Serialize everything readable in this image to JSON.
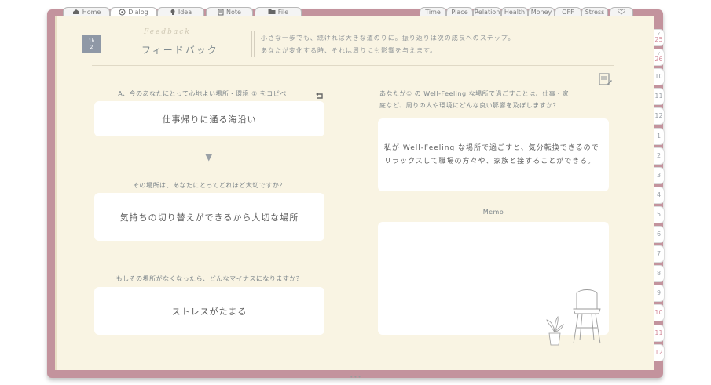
{
  "tabs_left": [
    {
      "label": "Home",
      "icon": "home-icon"
    },
    {
      "label": "Dialog",
      "icon": "dialog-icon"
    },
    {
      "label": "Idea",
      "icon": "lightbulb-icon"
    },
    {
      "label": "Note",
      "icon": "note-icon"
    },
    {
      "label": "File",
      "icon": "folder-icon"
    }
  ],
  "tabs_right": [
    {
      "label": "Time"
    },
    {
      "label": "Place"
    },
    {
      "label": "Relation"
    },
    {
      "label": "Health"
    },
    {
      "label": "Money"
    },
    {
      "label": "OFF"
    },
    {
      "label": "Stress"
    },
    {
      "label": "",
      "icon": "heart-icon"
    }
  ],
  "month_tabs": [
    {
      "year": "Y",
      "label": "25"
    },
    {
      "year": "Y",
      "label": "26"
    },
    {
      "label": "10"
    },
    {
      "label": "11"
    },
    {
      "label": "12"
    },
    {
      "label": "1"
    },
    {
      "label": "2"
    },
    {
      "label": "3"
    },
    {
      "label": "4"
    },
    {
      "label": "5"
    },
    {
      "label": "6"
    },
    {
      "label": "7"
    },
    {
      "label": "8"
    },
    {
      "label": "9"
    },
    {
      "label": "10"
    },
    {
      "label": "11"
    },
    {
      "label": "12"
    }
  ],
  "header": {
    "day_top": "1h",
    "day_bottom": "2",
    "script_title": "Feedback",
    "title": "フィードバック",
    "intro_line1": "小さな一歩でも、続ければ大きな道のりに。振り返りは次の成長へのステップ。",
    "intro_line2": "あなたが変化する時、それは周りにも影響を与えます。"
  },
  "left": {
    "q1": "A、今のあなたにとって心地よい場所・環境 ① をコピペ",
    "a1": "仕事帰りに通る海沿い",
    "arrow": "▼",
    "q2": "その場所は、あなたにとってどれほど大切ですか？",
    "a2": "気持ちの切り替えができるから大切な場所",
    "q3": "もしその場所がなくなったら、どんなマイナスになりますか？",
    "a3": "ストレスがたまる"
  },
  "right": {
    "q1_line1": "あなたが① の Well-Feeling な場所で過ごすことは、仕事・家",
    "q1_line2": "庭など、周りの人や環境にどんな良い影響を及ぼしますか？",
    "a1_line1": "私が Well-Feeling な場所で過ごすと、気分転換できるので",
    "a1_line2": "リラックスして職場の方々や、家族と接することができる。",
    "memo_label": "Memo"
  },
  "bottom_dots": "•••",
  "colors": {
    "cover": "#c3939d",
    "page": "#f9f4e3",
    "accent_pink": "#d48b9a",
    "text": "#7d868b"
  }
}
